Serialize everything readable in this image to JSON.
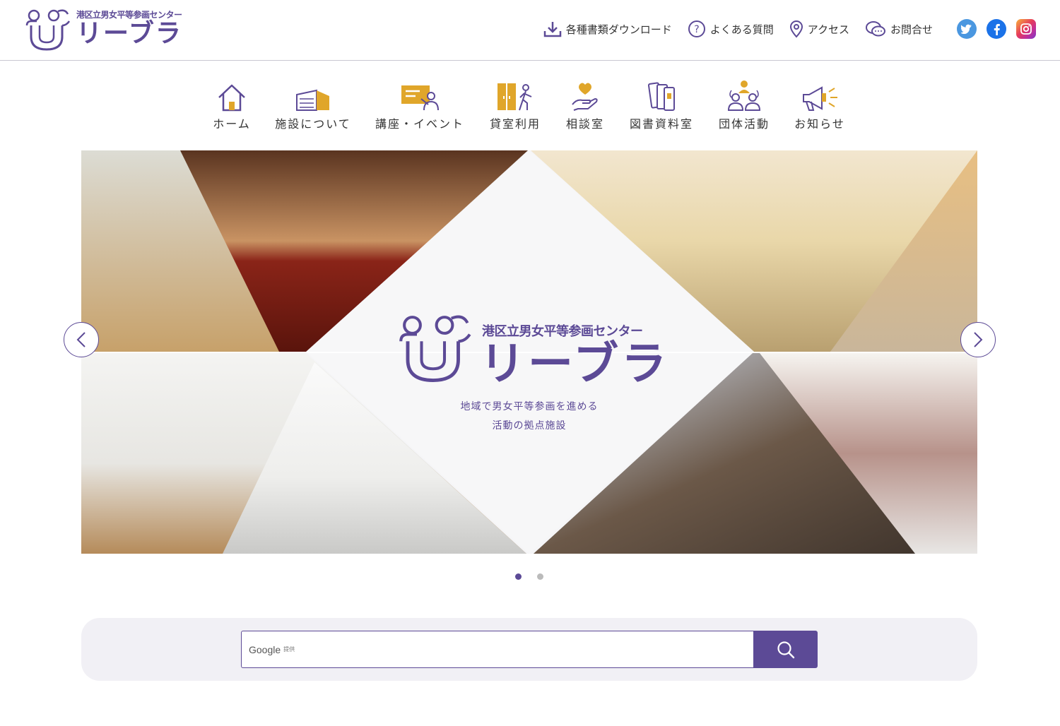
{
  "header": {
    "logo_sub": "港区立男女平等参画センター",
    "logo_main": "リーブラ",
    "links": [
      {
        "label": "各種書類ダウンロード",
        "icon": "download-icon"
      },
      {
        "label": "よくある質問",
        "icon": "question-icon"
      },
      {
        "label": "アクセス",
        "icon": "map-pin-icon"
      },
      {
        "label": "お問合せ",
        "icon": "chat-icon"
      }
    ],
    "social": [
      {
        "name": "twitter-icon",
        "color": "#4a97e0"
      },
      {
        "name": "facebook-icon",
        "color": "#1b72e8"
      },
      {
        "name": "instagram-icon",
        "color": "#e63c5b"
      }
    ]
  },
  "nav": {
    "items": [
      {
        "label": "ホーム",
        "icon": "home-icon"
      },
      {
        "label": "施設について",
        "icon": "building-icon"
      },
      {
        "label": "講座・イベント",
        "icon": "lecture-icon"
      },
      {
        "label": "貸室利用",
        "icon": "door-icon"
      },
      {
        "label": "相談室",
        "icon": "heart-hand-icon"
      },
      {
        "label": "図書資料室",
        "icon": "books-icon"
      },
      {
        "label": "団体活動",
        "icon": "group-icon"
      },
      {
        "label": "お知らせ",
        "icon": "megaphone-icon"
      }
    ]
  },
  "hero": {
    "sub": "港区立男女平等参画センター",
    "main": "リーブラ",
    "tagline_1": "地域で男女平等参画を進める",
    "tagline_2": "活動の拠点施設",
    "slides": 2,
    "active_slide": 1
  },
  "search": {
    "brand": "Google",
    "provided": "提供"
  },
  "colors": {
    "accent": "#5c4a96",
    "gold": "#e0a62a"
  }
}
